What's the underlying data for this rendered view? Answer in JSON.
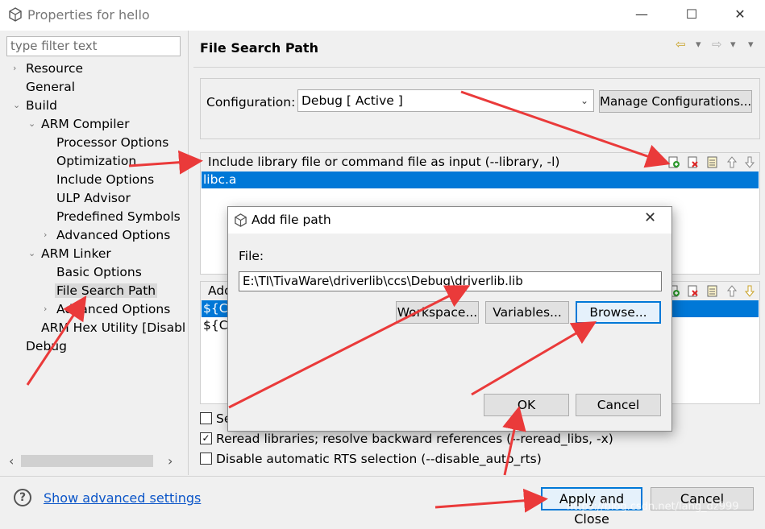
{
  "window": {
    "title": "Properties for hello",
    "controls": [
      "—",
      "☐",
      "✕"
    ]
  },
  "sidebar": {
    "filter_placeholder": "type filter text",
    "tree": [
      {
        "label": "Resource",
        "arrow": "›"
      },
      {
        "label": "General",
        "arrow": ""
      },
      {
        "label": "Build",
        "arrow": "⌄"
      },
      {
        "label": "ARM Compiler",
        "arrow": "⌄"
      },
      {
        "label": "Processor Options",
        "arrow": ""
      },
      {
        "label": "Optimization",
        "arrow": ""
      },
      {
        "label": "Include Options",
        "arrow": ""
      },
      {
        "label": "ULP Advisor",
        "arrow": ""
      },
      {
        "label": "Predefined Symbols",
        "arrow": ""
      },
      {
        "label": "Advanced Options",
        "arrow": "›"
      },
      {
        "label": "ARM Linker",
        "arrow": "⌄"
      },
      {
        "label": "Basic Options",
        "arrow": ""
      },
      {
        "label": "File Search Path",
        "arrow": ""
      },
      {
        "label": "Advanced Options",
        "arrow": "›"
      },
      {
        "label": "ARM Hex Utility  [Disabl",
        "arrow": ""
      },
      {
        "label": "Debug",
        "arrow": ""
      }
    ],
    "scroll_left": "‹",
    "scroll_right": "›"
  },
  "panel": {
    "title": "File Search Path",
    "nav": [
      "⇦",
      "▾",
      "⇨",
      "▾",
      "▾"
    ],
    "config_label": "Configuration:",
    "config_value": "Debug  [ Active ]",
    "manage_button": "Manage Configurations...",
    "library_header": "Include library file or command file as input (--library, -l)",
    "library_items": [
      "libc.a"
    ],
    "search_header": "Add",
    "search_items": [
      "${CG",
      "${CG"
    ],
    "checkboxes": [
      {
        "label": "Se",
        "checked": false
      },
      {
        "label": "Reread libraries; resolve backward references (--reread_libs, -x)",
        "checked": true
      },
      {
        "label": "Disable automatic RTS selection (--disable_auto_rts)",
        "checked": false
      }
    ],
    "check_mark": "✓"
  },
  "bottom": {
    "help_glyph": "?",
    "advanced_link": "Show advanced settings",
    "apply_close": "Apply and Close",
    "cancel": "Cancel"
  },
  "dialog": {
    "title": "Add file path",
    "close": "✕",
    "file_label": "File:",
    "file_value": "E:\\TI\\TivaWare\\driverlib\\ccs\\Debug\\driverlib.lib",
    "workspace_button": "Workspace...",
    "variables_button": "Variables...",
    "browse_button": "Browse...",
    "ok_button": "OK",
    "cancel_button": "Cancel"
  },
  "watermark": "https://blog.csdn.net/lang_dz999",
  "colors": {
    "selection": "#0078d7",
    "link": "#0b55c8",
    "annotation_arrow": "#ea3a3a"
  },
  "icons": [
    "app-icon",
    "add-icon",
    "delete-icon",
    "edit-icon",
    "move-up-icon",
    "move-down-icon",
    "help-icon",
    "back-icon",
    "forward-icon"
  ]
}
